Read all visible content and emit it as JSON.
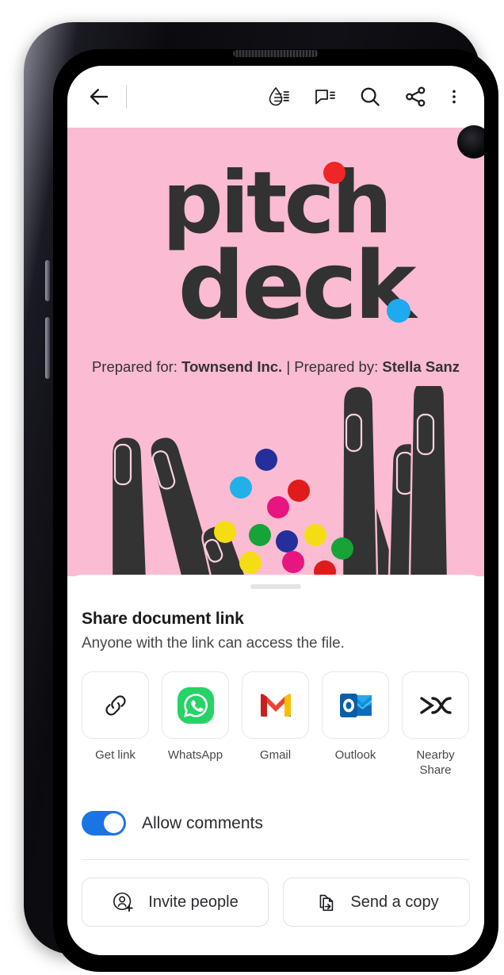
{
  "device": {
    "type": "android-smartphone",
    "camera": "punch-hole-front-camera",
    "earpiece": "earpiece-speaker"
  },
  "toolbar": {
    "back_label": "Back",
    "icons": [
      {
        "name": "back-arrow-icon",
        "label": "Back"
      },
      {
        "name": "highlight-ink-icon",
        "label": "Highlight"
      },
      {
        "name": "comment-icon",
        "label": "Comments"
      },
      {
        "name": "search-icon",
        "label": "Search"
      },
      {
        "name": "share-icon",
        "label": "Share"
      },
      {
        "name": "overflow-menu-icon",
        "label": "More options"
      }
    ]
  },
  "document": {
    "background_color": "#fbbbd2",
    "title_line_1": "pitch",
    "title_line_2": "deck",
    "accent_dot_red": "#ef2626",
    "accent_dot_blue": "#1fa9ee",
    "subtitle_prefix_1": "Prepared for: ",
    "subtitle_value_1": "Townsend Inc.",
    "subtitle_separator": " | ",
    "subtitle_prefix_2": "Prepared by: ",
    "subtitle_value_2": "Stella Sanz",
    "illustration": "hands-with-confetti"
  },
  "share_sheet": {
    "title": "Share document link",
    "subtitle": "Anyone with the link can access the file.",
    "targets": [
      {
        "id": "get-link",
        "label": "Get link",
        "icon": "link-icon"
      },
      {
        "id": "whatsapp",
        "label": "WhatsApp",
        "icon": "whatsapp-icon",
        "color": "#25D366"
      },
      {
        "id": "gmail",
        "label": "Gmail",
        "icon": "gmail-icon",
        "color": "#EA4335"
      },
      {
        "id": "outlook",
        "label": "Outlook",
        "icon": "outlook-icon",
        "color": "#0F6CBD"
      },
      {
        "id": "nearby-share",
        "label": "Nearby Share",
        "icon": "nearby-share-icon"
      }
    ],
    "allow_comments": {
      "label": "Allow comments",
      "enabled": true,
      "on_color": "#1b74e4"
    },
    "actions": [
      {
        "id": "invite-people",
        "label": "Invite people",
        "icon": "person-add-icon"
      },
      {
        "id": "send-a-copy",
        "label": "Send a copy",
        "icon": "copy-document-icon"
      }
    ]
  }
}
